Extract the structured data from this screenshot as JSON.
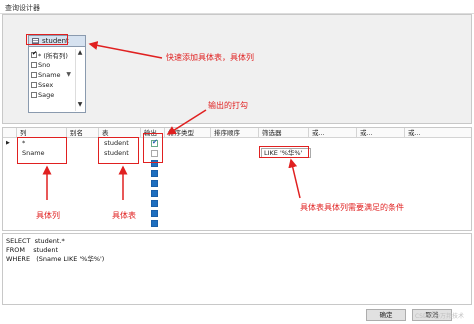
{
  "window": {
    "title": "查询设计器"
  },
  "diagram": {
    "table": {
      "name": "student",
      "filter_icon": "funnel-icon",
      "columns": [
        {
          "label": "* (所有列)",
          "checked": true
        },
        {
          "label": "Sno",
          "checked": false
        },
        {
          "label": "Sname",
          "checked": false
        },
        {
          "label": "Ssex",
          "checked": false
        },
        {
          "label": "Sage",
          "checked": false
        }
      ]
    }
  },
  "grid": {
    "headers": [
      "列",
      "别名",
      "表",
      "输出",
      "排序类型",
      "排序顺序",
      "筛选器",
      "或...",
      "或...",
      "或..."
    ],
    "rows": [
      {
        "column": "*",
        "alias": "",
        "table": "student",
        "output": true,
        "filter": ""
      },
      {
        "column": "Sname",
        "alias": "",
        "table": "student",
        "output": false,
        "filter": "LIKE '%华%'"
      }
    ]
  },
  "sql": {
    "lines": [
      "SELECT  student.*",
      "FROM    student",
      "WHERE   (Sname LIKE '%华%')"
    ]
  },
  "footer": {
    "ok_label": "确定",
    "cancel_label": "取消",
    "watermark": "CSDN @万邦技术"
  },
  "annotations": {
    "quick_add": "快速添加具体表，具体列",
    "output_print": "输出的打勾",
    "specific_column": "具体列",
    "specific_table": "具体表",
    "condition": "具体表具体列需要满足的条件"
  },
  "colors": {
    "annotation": "#e02020",
    "selected_check": "#1f6fbf"
  }
}
